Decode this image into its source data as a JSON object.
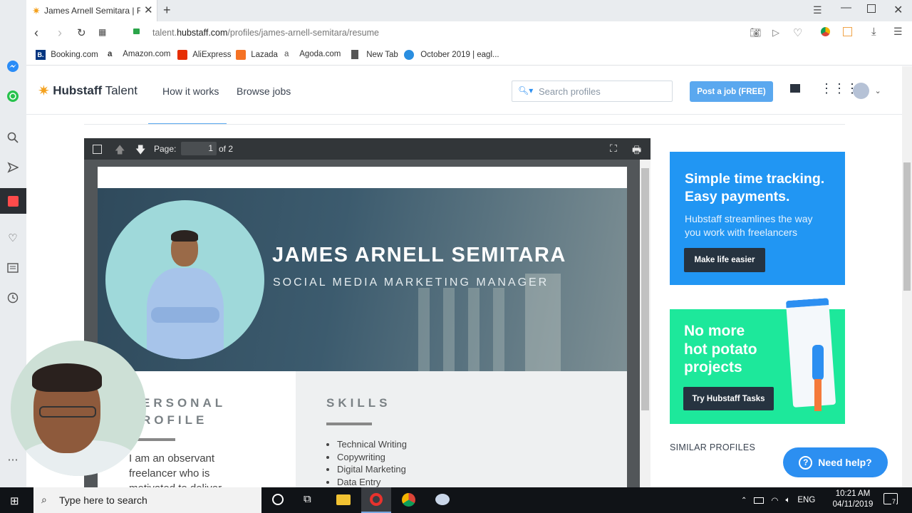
{
  "browser": {
    "tab_title": "James Arnell Semitara | Fre",
    "url_host": "talent.",
    "url_domain": "hubstaff.com",
    "url_path": "/profiles/james-arnell-semitara/resume",
    "bookmarks": [
      "Booking.com",
      "Amazon.com",
      "AliExpress",
      "Lazada",
      "Agoda.com",
      "New Tab",
      "October 2019 | eagl..."
    ]
  },
  "site": {
    "logo_bold": "Hubstaff",
    "logo_light": " Talent",
    "nav": [
      "How it works",
      "Browse jobs"
    ],
    "search_placeholder": "Search profiles",
    "post_button": "Post a job (FREE)"
  },
  "pdf": {
    "page_label": "Page:",
    "page_value": "1",
    "page_total": "of 2"
  },
  "resume": {
    "name": "JAMES ARNELL SEMITARA",
    "role": "SOCIAL MEDIA MARKETING MANAGER",
    "personal_line1": "ERSONAL",
    "personal_line2": "ROFILE",
    "profile_lines": [
      "I am an observant",
      "freelancer who is",
      "motivated to deliver"
    ],
    "skills_heading": "SKILLS",
    "skills": [
      "Technical Writing",
      "Copywriting",
      "Digital Marketing",
      "Data Entry"
    ]
  },
  "ads": {
    "ad1_title1": "Simple time tracking.",
    "ad1_title2": "Easy payments.",
    "ad1_sub1": "Hubstaff streamlines the way",
    "ad1_sub2": "you work with freelancers",
    "ad1_button": "Make life easier",
    "ad2_title1": "No more",
    "ad2_title2": "hot potato",
    "ad2_title3": "projects",
    "ad2_button": "Try Hubstaff Tasks"
  },
  "similar_profiles": "SIMILAR PROFILES",
  "help_button": "Need help?",
  "taskbar": {
    "search_placeholder": "Type here to search",
    "language": "ENG",
    "time": "10:21 AM",
    "date": "04/11/2019",
    "notifications": "7"
  },
  "colors": {
    "brand_blue": "#2196f3",
    "brand_green": "#1de89b",
    "post_button": "#5aa8ef",
    "help_button": "#2c8ff1"
  }
}
